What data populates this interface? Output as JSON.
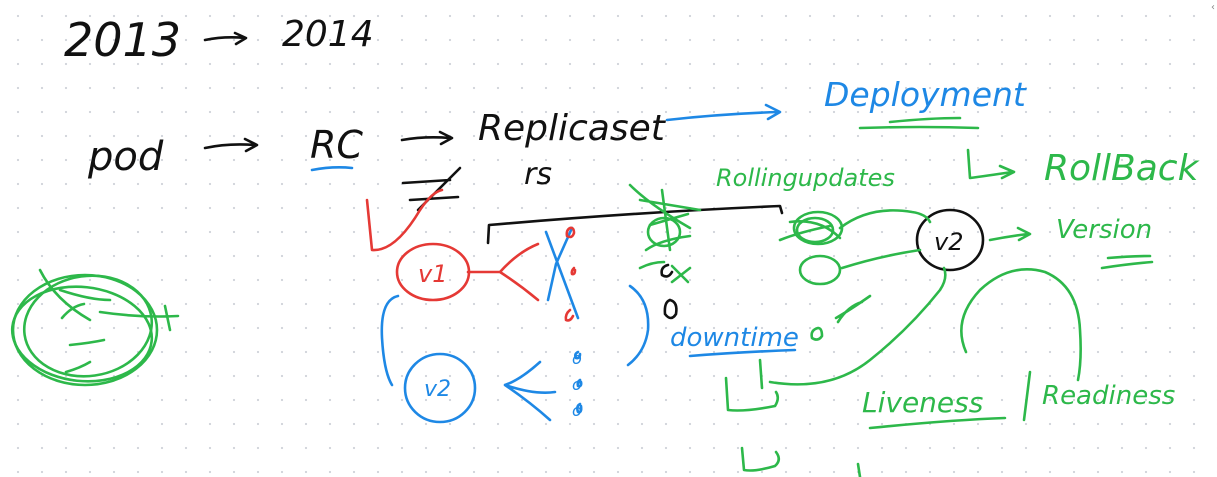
{
  "whiteboard": {
    "collapse_glyph": "‹",
    "ink_colors": {
      "black": "#111111",
      "blue": "#1e88e5",
      "green": "#2db84a",
      "red": "#e53935"
    }
  },
  "notes": {
    "year_from": "2013",
    "year_to": "2014",
    "pod": "pod",
    "rc": "RC",
    "replicaset": "Replicaset",
    "rs": "rs",
    "deployment": "Deployment",
    "rolling_updates": "Rollingupdates",
    "rollback": "RollBack",
    "version": "Version",
    "v1": "v1",
    "v2_black": "v2",
    "v2_blue": "v2",
    "downtime": "downtime",
    "liveness": "Liveness",
    "readiness": "Readiness",
    "pod_circles": [
      "o",
      "o",
      "o"
    ]
  }
}
